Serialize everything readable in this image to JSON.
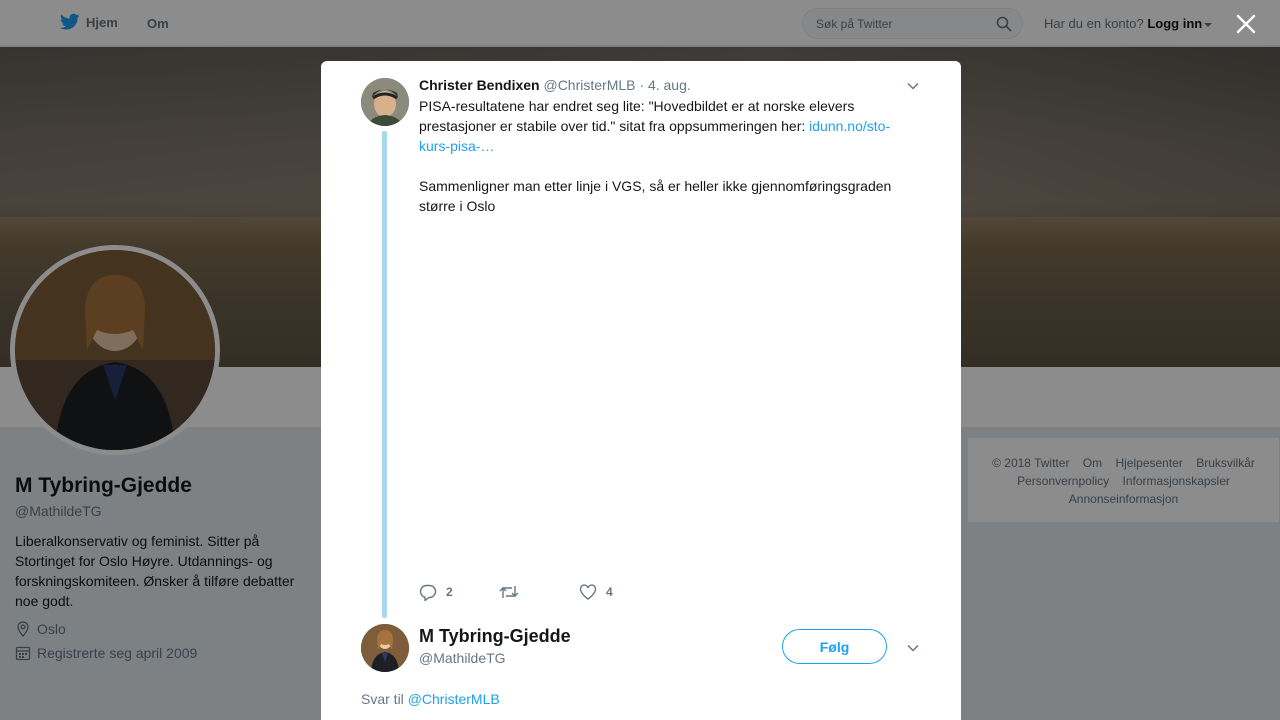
{
  "nav": {
    "home_label": "Hjem",
    "about_label": "Om",
    "search_placeholder": "Søk på Twitter",
    "account_question": "Har du en konto?",
    "login_label": "Logg inn"
  },
  "profile": {
    "name": "M Tybring-Gjedde",
    "handle": "@MathildeTG",
    "bio": "Liberalkonservativ og feminist. Sitter på Stortinget for Oslo Høyre. Utdannings- og forskningskomiteen. Ønsker å tilføre debatter noe godt.",
    "location": "Oslo",
    "joined": "Registrerte seg april 2009"
  },
  "footer": {
    "links": [
      "© 2018 Twitter",
      "Om",
      "Hjelpesenter",
      "Bruksvilkår",
      "Personvernpolicy",
      "Informasjonskapsler",
      "Annonseinformasjon"
    ]
  },
  "tweet": {
    "author_name": "Christer Bendixen",
    "author_handle": "@ChristerMLB",
    "separator": "·",
    "date": "4. aug.",
    "text_part1": "PISA-resultatene har endret seg lite: \"Hovedbildet er at norske elevers prestasjoner er stabile over tid.\" sitat fra oppsummeringen her: ",
    "link_text": "idunn.no/sto-kurs-pisa-…",
    "text_part2": "Sammenligner man etter linje i VGS, så er heller ikke gjennomføringsgraden større i Oslo",
    "reply_count": "2",
    "retweet_count": "",
    "like_count": "4"
  },
  "reply": {
    "author_name": "M Tybring-Gjedde",
    "author_handle": "@MathildeTG",
    "follow_label": "Følg",
    "reply_prefix": "Svar til",
    "reply_handle": "@ChristerMLB"
  },
  "colors": {
    "accent": "#1da1f2",
    "thread_line": "#a8d8f0",
    "muted_text": "#657786"
  },
  "icons": [
    "twitter-bird-icon",
    "search-icon",
    "close-icon",
    "chevron-down-icon",
    "reply-icon",
    "retweet-icon",
    "heart-icon",
    "location-pin-icon",
    "calendar-icon"
  ]
}
